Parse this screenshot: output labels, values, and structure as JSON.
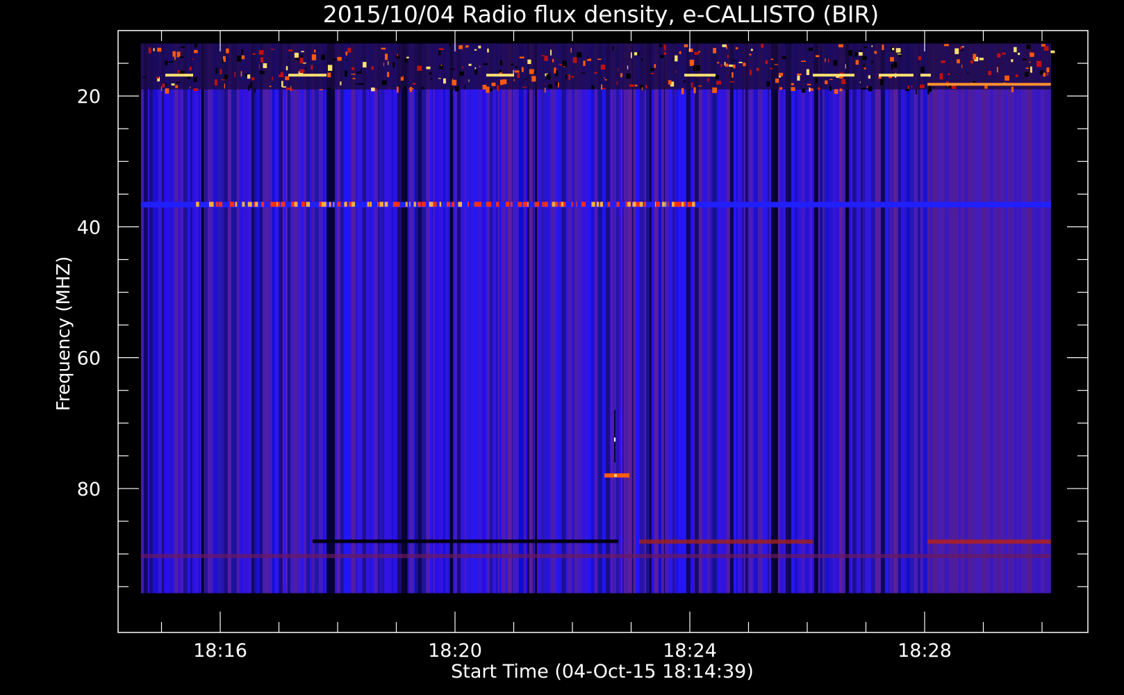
{
  "chart_data": {
    "type": "heatmap",
    "title": "2015/10/04  Radio flux density, e-CALLISTO (BIR)",
    "xlabel": "Start Time (04-Oct-15 18:14:39)",
    "ylabel": "Frequency (MHZ)",
    "x_tick_labels": [
      "18:16",
      "18:20",
      "18:24",
      "18:28"
    ],
    "y_tick_labels": [
      "20",
      "40",
      "60",
      "80"
    ],
    "ylim": [
      100,
      10
    ],
    "x_axis_range_minutes": [
      18.22,
      18.5
    ],
    "y_axis_range_mhz": [
      10,
      102
    ],
    "data_extent": {
      "time_start": "18:14:39",
      "time_end": "18:30:09",
      "freq_min_mhz": 12,
      "freq_max_mhz": 96
    },
    "colormap": [
      "#000000",
      "#0000ff",
      "#7f1f7f",
      "#ff3000",
      "#ffff80"
    ],
    "features": [
      {
        "label": "interference band",
        "freq_mhz": [
          12,
          19
        ],
        "intensity": "high"
      },
      {
        "label": "narrowband line",
        "freq_mhz": 36.5,
        "intensity": "high"
      },
      {
        "label": "burst",
        "freq_mhz": 78,
        "time": "18:22:40",
        "intensity": "high"
      },
      {
        "label": "band",
        "freq_mhz": 88,
        "intensity": "medium"
      }
    ]
  }
}
